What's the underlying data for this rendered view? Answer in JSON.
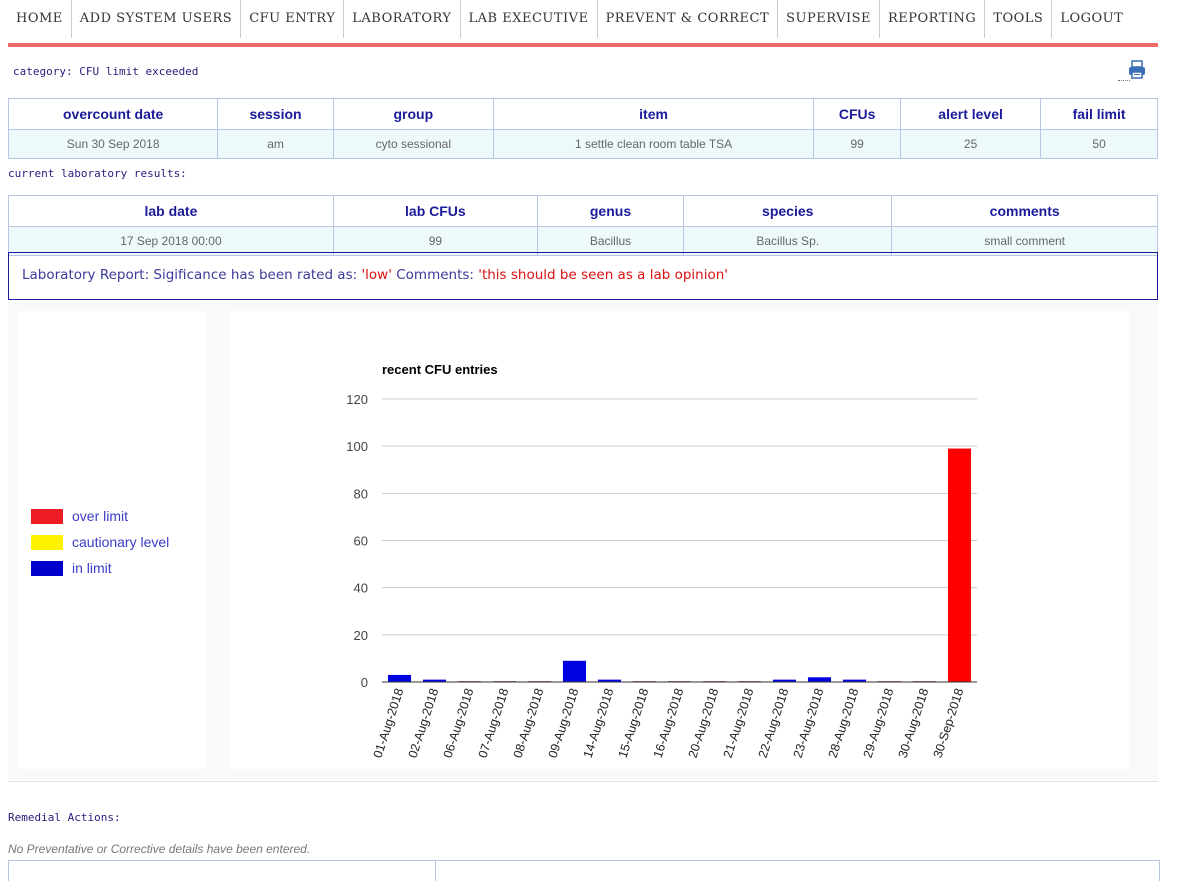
{
  "nav": {
    "items": [
      "HOME",
      "ADD SYSTEM USERS",
      "CFU ENTRY",
      "LABORATORY",
      "LAB EXECUTIVE",
      "PREVENT & CORRECT",
      "SUPERVISE",
      "REPORTING",
      "TOOLS",
      "LOGOUT"
    ]
  },
  "category_label": "category: CFU limit exceeded",
  "icons": {
    "print": "printer-icon"
  },
  "overcount_table": {
    "headers": [
      "overcount date",
      "session",
      "group",
      "item",
      "CFUs",
      "alert level",
      "fail limit"
    ],
    "row": [
      "Sun 30 Sep 2018",
      "am",
      "cyto sessional",
      "1 settle clean room table TSA",
      "99",
      "25",
      "50"
    ]
  },
  "lab_results_label": "current laboratory results:",
  "lab_table": {
    "headers": [
      "lab date",
      "lab CFUs",
      "genus",
      "species",
      "comments"
    ],
    "row": [
      "17 Sep 2018 00:00",
      "99",
      "Bacillus",
      "Bacillus Sp.",
      "small comment"
    ]
  },
  "report": {
    "prefix": "Laboratory Report: Sigificance has been rated as: ",
    "rating": "'low'",
    "comments_label": " Comments: ",
    "comment": "'this should be seen as a lab opinion'"
  },
  "legend": [
    {
      "label": "over limit",
      "color": "#ee1c25"
    },
    {
      "label": "cautionary level",
      "color": "#fff200"
    },
    {
      "label": "in limit",
      "color": "#0000cc"
    }
  ],
  "chart_data": {
    "type": "bar",
    "title": "recent CFU entries",
    "xlabel": "",
    "ylabel": "",
    "ylim": [
      0,
      120
    ],
    "yticks": [
      0,
      20,
      40,
      60,
      80,
      100,
      120
    ],
    "grid": true,
    "categories": [
      "01-Aug-2018",
      "02-Aug-2018",
      "06-Aug-2018",
      "07-Aug-2018",
      "08-Aug-2018",
      "09-Aug-2018",
      "14-Aug-2018",
      "15-Aug-2018",
      "16-Aug-2018",
      "20-Aug-2018",
      "21-Aug-2018",
      "22-Aug-2018",
      "23-Aug-2018",
      "28-Aug-2018",
      "29-Aug-2018",
      "30-Aug-2018",
      "30-Sep-2018"
    ],
    "values": [
      3,
      1,
      0,
      0,
      0,
      9,
      1,
      0,
      0,
      0,
      0,
      1,
      2,
      1,
      0,
      0,
      99
    ],
    "status": [
      "in",
      "in",
      "in",
      "in",
      "in",
      "in",
      "in",
      "in",
      "in",
      "in",
      "in",
      "in",
      "in",
      "in",
      "in",
      "in",
      "over"
    ],
    "colors": {
      "over": "#ff0000",
      "caution": "#fff200",
      "in": "#0000e0",
      "zero": "#b07070"
    }
  },
  "remedial_label": "Remedial Actions:",
  "no_prev_text": "No Preventative or Corrective details have been entered."
}
